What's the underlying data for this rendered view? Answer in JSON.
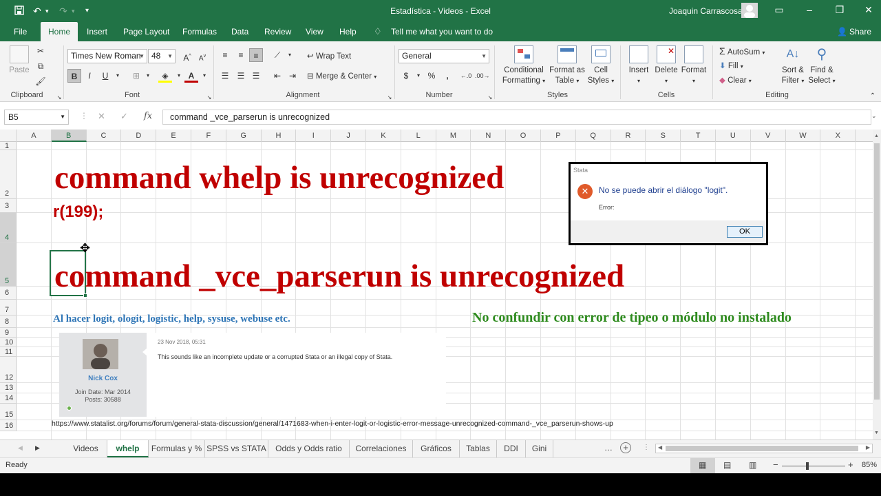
{
  "window": {
    "title": "Estadística - Videos  -  Excel",
    "user": "Joaquin Carrascosa"
  },
  "ribbon_tabs": [
    "File",
    "Home",
    "Insert",
    "Page Layout",
    "Formulas",
    "Data",
    "Review",
    "View",
    "Help"
  ],
  "tell_me": "Tell me what you want to do",
  "share": "Share",
  "ribbon": {
    "clipboard": {
      "label": "Clipboard",
      "paste": "Paste"
    },
    "font": {
      "label": "Font",
      "name": "Times New Roman",
      "size": "48",
      "bold": "B",
      "italic": "I",
      "underline": "U"
    },
    "alignment": {
      "label": "Alignment",
      "wrap": "Wrap Text",
      "merge": "Merge & Center"
    },
    "number": {
      "label": "Number",
      "format": "General",
      "currency": "$",
      "percent": "%",
      "comma": ","
    },
    "styles": {
      "label": "Styles",
      "conditional_1": "Conditional",
      "conditional_2": "Formatting",
      "format_table_1": "Format as",
      "format_table_2": "Table",
      "cell_styles_1": "Cell",
      "cell_styles_2": "Styles"
    },
    "cells": {
      "label": "Cells",
      "insert": "Insert",
      "delete": "Delete",
      "format": "Format"
    },
    "editing": {
      "label": "Editing",
      "autosum": "AutoSum",
      "fill": "Fill",
      "clear": "Clear",
      "sort_1": "Sort &",
      "sort_2": "Filter",
      "find_1": "Find &",
      "find_2": "Select"
    }
  },
  "formula_bar": {
    "name_box": "B5",
    "fx": "fx",
    "content": "command _vce_parserun is unrecognized"
  },
  "columns": [
    "A",
    "B",
    "C",
    "D",
    "E",
    "F",
    "G",
    "H",
    "I",
    "J",
    "K",
    "L",
    "M",
    "N",
    "O",
    "P",
    "Q",
    "R",
    "S",
    "T",
    "U",
    "V",
    "W",
    "X"
  ],
  "rows": [
    "1",
    "2",
    "3",
    "4",
    "5",
    "6",
    "7",
    "8",
    "9",
    "10",
    "11",
    "12",
    "13",
    "14",
    "15",
    "16"
  ],
  "cells": {
    "b2": "command whelp is unrecognized",
    "b3": "r(199);",
    "b5": "command _vce_parserun is unrecognized",
    "b7": "Al hacer logit, ologit, logistic, help, sysuse, webuse etc.",
    "n7": "No confundir con error de tipeo o módulo no instalado",
    "b15": "https://www.statalist.org/forums/forum/general-stata-discussion/general/1471683-when-i-enter-logit-or-logistic-error-message-unrecognized-command-_vce_parserun-shows-up"
  },
  "dialog": {
    "title": "Stata",
    "message": "No se puede abrir el diálogo \"logit\".",
    "detail": "Error:",
    "ok": "OK"
  },
  "forum_post": {
    "author": "Nick Cox",
    "join_date": "Join Date: Mar 2014",
    "posts": "Posts: 30588",
    "date": "23 Nov 2018, 05:31",
    "body": "This sounds like an incomplete update or a corrupted Stata or an illegal copy of Stata."
  },
  "sheet_tabs": [
    "Videos",
    "whelp",
    "Formulas y %",
    "SPSS vs STATA",
    "Odds y Odds ratio",
    "Correlaciones",
    "Gráficos",
    "Tablas",
    "DDI",
    "Gini"
  ],
  "active_sheet": "whelp",
  "status": {
    "left": "Ready",
    "zoom": "85%"
  },
  "colors": {
    "excel_green": "#217346",
    "red_text": "#c00000",
    "blue_text": "#2e75b6",
    "green_text": "#2e8b1e"
  }
}
